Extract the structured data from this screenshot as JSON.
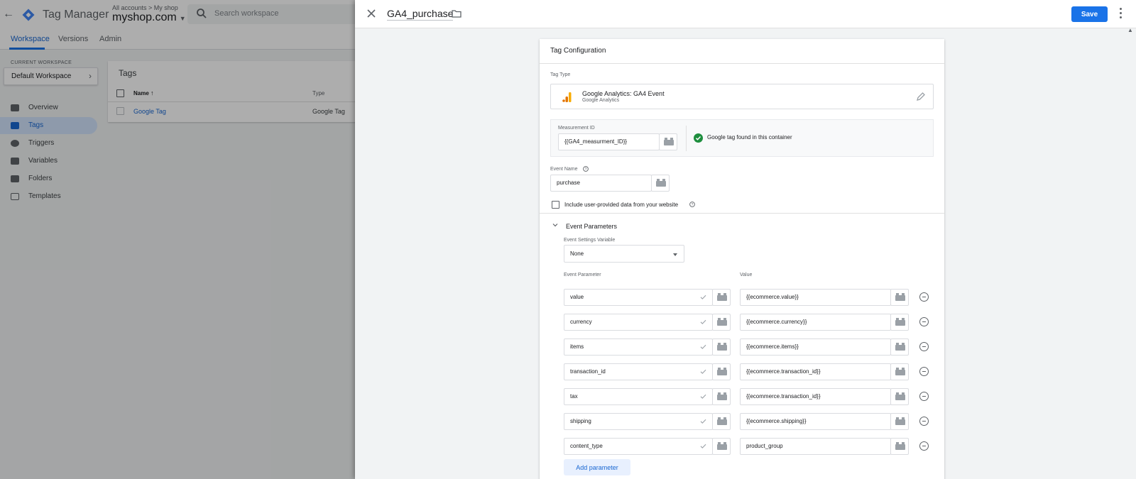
{
  "background": {
    "app_name": "Tag Manager",
    "breadcrumb": "All accounts > My shop",
    "account": "myshop.com",
    "search_placeholder": "Search workspace",
    "tabs": [
      "Workspace",
      "Versions",
      "Admin"
    ],
    "current_workspace_label": "CURRENT WORKSPACE",
    "current_workspace": "Default Workspace",
    "nav": [
      "Overview",
      "Tags",
      "Triggers",
      "Variables",
      "Folders",
      "Templates"
    ],
    "tags_card": {
      "title": "Tags",
      "col_name": "Name",
      "col_type": "Type",
      "rows": [
        {
          "name": "Google Tag",
          "type": "Google Tag"
        }
      ]
    }
  },
  "editor": {
    "title": "GA4_purchase",
    "save_label": "Save",
    "card_title": "Tag Configuration",
    "tag_type_label": "Tag Type",
    "tag_type_name": "Google Analytics: GA4 Event",
    "tag_type_sub": "Google Analytics",
    "measurement_label": "Measurement ID",
    "measurement_value": "{{GA4_measurment_ID}}",
    "google_tag_status": "Google tag found in this container",
    "event_name_label": "Event Name",
    "event_name_value": "purchase",
    "user_data_label": "Include user-provided data from your website",
    "event_params_title": "Event Parameters",
    "event_settings_label": "Event Settings Variable",
    "event_settings_value": "None",
    "param_col": "Event Parameter",
    "value_col": "Value",
    "params": [
      {
        "name": "value",
        "value": "{{ecommerce.value}}"
      },
      {
        "name": "currency",
        "value": "{{ecommerce.currency}}"
      },
      {
        "name": "items",
        "value": "{{ecommerce.items}}"
      },
      {
        "name": "transaction_id",
        "value": "{{ecommerce.transaction_id}}"
      },
      {
        "name": "tax",
        "value": "{{ecommerce.transaction_id}}"
      },
      {
        "name": "shipping",
        "value": "{{ecommerce.shipping}}"
      },
      {
        "name": "content_type",
        "value": "product_group"
      }
    ],
    "add_param_label": "Add parameter"
  },
  "colors": {
    "accent": "#1a73e8",
    "success": "#1e8e3e",
    "ga_orange": "#f9ab00"
  }
}
